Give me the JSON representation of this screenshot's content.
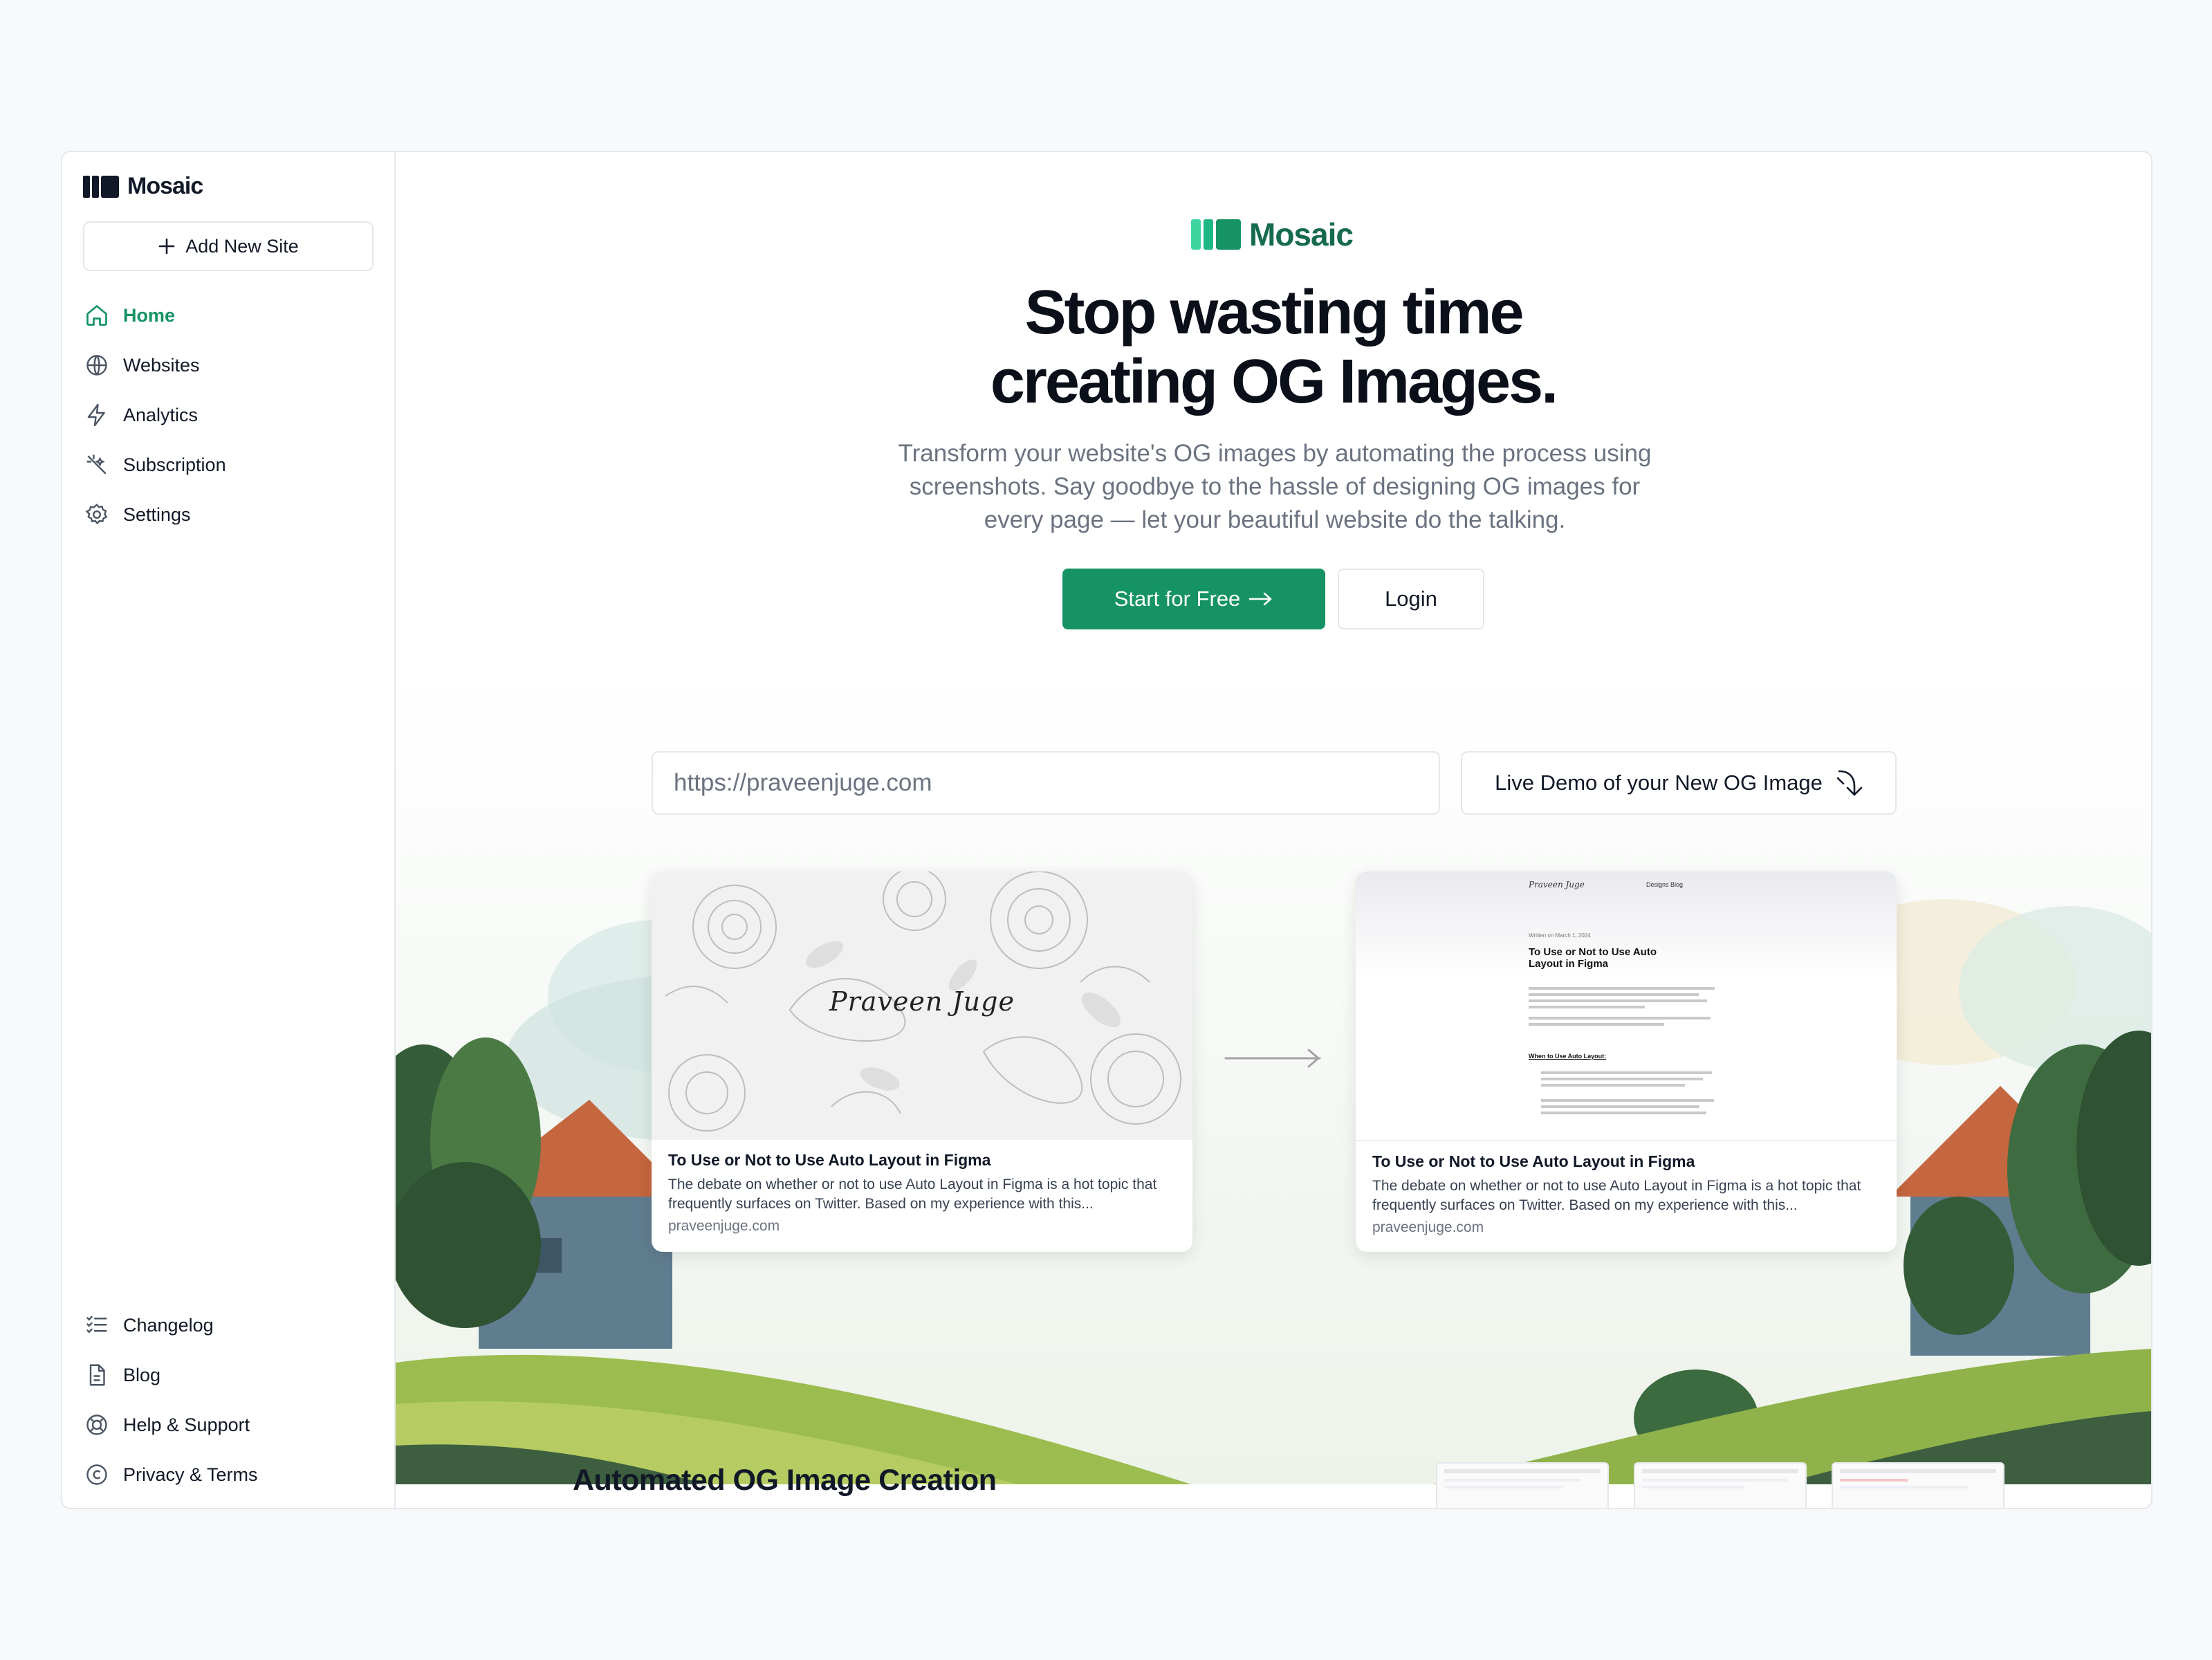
{
  "app": {
    "name": "Mosaic"
  },
  "sidebar": {
    "add_site_label": "Add New Site",
    "nav_top": [
      {
        "label": "Home",
        "icon": "home-icon",
        "active": true
      },
      {
        "label": "Websites",
        "icon": "globe-icon"
      },
      {
        "label": "Analytics",
        "icon": "lightning-icon"
      },
      {
        "label": "Subscription",
        "icon": "sparkle-icon"
      },
      {
        "label": "Settings",
        "icon": "gear-icon"
      }
    ],
    "nav_bottom": [
      {
        "label": "Changelog",
        "icon": "checklist-icon"
      },
      {
        "label": "Blog",
        "icon": "document-icon"
      },
      {
        "label": "Help & Support",
        "icon": "lifebuoy-icon"
      },
      {
        "label": "Privacy & Terms",
        "icon": "copyright-icon"
      }
    ]
  },
  "hero": {
    "brand": "Mosaic",
    "headline_line1": "Stop wasting time",
    "headline_line2": "creating OG Images.",
    "subtitle": "Transform your website's OG images by automating the process using screenshots. Say goodbye to the hassle of designing OG images for every page — let your beautiful website do the talking.",
    "primary_cta": "Start for Free",
    "secondary_cta": "Login"
  },
  "demo": {
    "url_value": "https://praveenjuge.com",
    "demo_button": "Live Demo of your New OG Image",
    "before_card": {
      "image_text": "Praveen Juge",
      "title": "To Use or Not to Use Auto Layout in Figma",
      "description": "The debate on whether or not to use Auto Layout in Figma is a hot topic that frequently surfaces on Twitter. Based on my experience with this...",
      "domain": "praveenjuge.com"
    },
    "after_card": {
      "preview_site_name": "Praveen Juge",
      "preview_nav": "Designs  Blog",
      "preview_date": "Written on March 1, 2024",
      "preview_heading": "To Use or Not to Use Auto Layout in Figma",
      "preview_subheading": "When to Use Auto Layout:",
      "title": "To Use or Not to Use Auto Layout in Figma",
      "description": "The debate on whether or not to use Auto Layout in Figma is a hot topic that frequently surfaces on Twitter. Based on my experience with this...",
      "domain": "praveenjuge.com"
    }
  },
  "section": {
    "title": "Automated OG Image Creation"
  },
  "colors": {
    "brand_green": "#169365",
    "brand_dark_green": "#166b4e",
    "text": "#111827",
    "muted": "#6b7280"
  }
}
